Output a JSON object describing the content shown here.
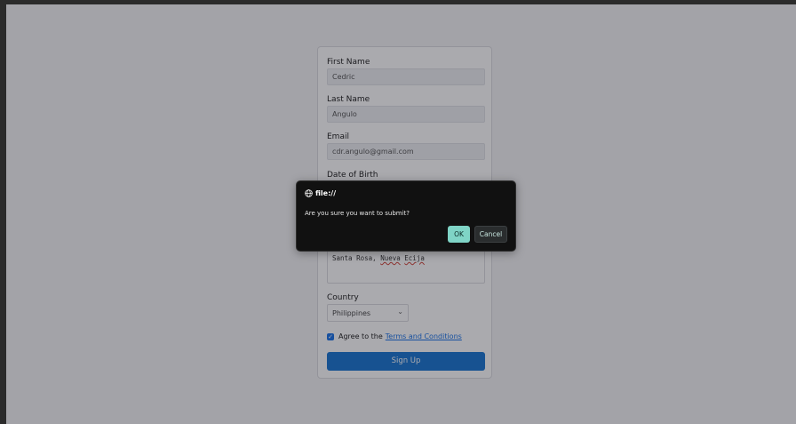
{
  "form": {
    "first_name_label": "First Name",
    "first_name_value": "Cedric",
    "last_name_label": "Last Name",
    "last_name_value": "Angulo",
    "email_label": "Email",
    "email_value": "cdr.angulo@gmail.com",
    "dob_label": "Date of Birth",
    "address_value_plain": "Santa Rosa, ",
    "address_value_word1": "Nueva",
    "address_value_word2": "Ecija",
    "country_label": "Country",
    "country_selected": "Philippines",
    "agree_text": "Agree to the",
    "terms_link": "Terms and Conditions",
    "agree_checked": true,
    "submit_label": "Sign Up"
  },
  "dialog": {
    "origin": "file://",
    "message": "Are you sure you want to submit?",
    "ok_label": "OK",
    "cancel_label": "Cancel"
  },
  "colors": {
    "accent": "#1976d2",
    "dialog_bg": "#111111",
    "ok_button": "#7fd4c6"
  },
  "icons": {
    "origin_icon": "globe-icon",
    "select_icon": "chevron-down-icon",
    "checkbox_icon": "check-icon"
  }
}
